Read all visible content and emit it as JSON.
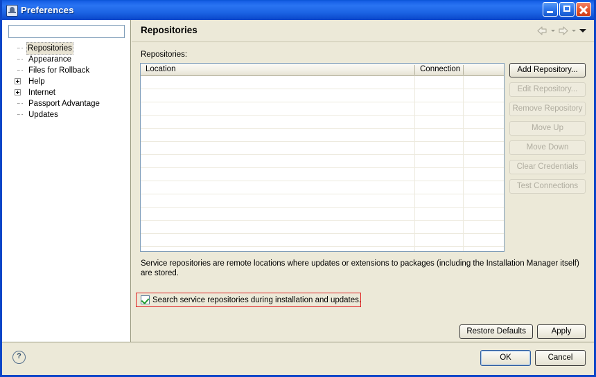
{
  "window": {
    "title": "Preferences",
    "icon": "app-icon",
    "controls": {
      "minimize": "minimize-icon",
      "maximize": "maximize-icon",
      "close": "close-icon"
    }
  },
  "sidebar": {
    "filter": {
      "value": "",
      "placeholder": ""
    },
    "tree": [
      {
        "label": "Repositories",
        "expandable": false,
        "selected": true
      },
      {
        "label": "Appearance",
        "expandable": false,
        "selected": false
      },
      {
        "label": "Files for Rollback",
        "expandable": false,
        "selected": false
      },
      {
        "label": "Help",
        "expandable": true,
        "selected": false
      },
      {
        "label": "Internet",
        "expandable": true,
        "selected": false
      },
      {
        "label": "Passport Advantage",
        "expandable": false,
        "selected": false
      },
      {
        "label": "Updates",
        "expandable": false,
        "selected": false
      }
    ]
  },
  "content": {
    "page_title": "Repositories",
    "nav": {
      "back": "back-arrow-icon",
      "back_caret": "chevron-down-icon",
      "forward": "forward-arrow-icon",
      "forward_caret": "chevron-down-icon",
      "menu": "dropdown-arrow-icon"
    },
    "section_label": "Repositories:",
    "table": {
      "columns": [
        "Location",
        "Connection",
        ""
      ],
      "rows": [],
      "empty_row_count": 13
    },
    "side_buttons": [
      {
        "label": "Add Repository...",
        "enabled": true
      },
      {
        "label": "Edit Repository...",
        "enabled": false
      },
      {
        "label": "Remove Repository",
        "enabled": false
      },
      {
        "label": "Move Up",
        "enabled": false
      },
      {
        "label": "Move Down",
        "enabled": false
      },
      {
        "label": "Clear Credentials",
        "enabled": false
      },
      {
        "label": "Test Connections",
        "enabled": false
      }
    ],
    "description": "Service repositories are remote locations where updates or extensions to packages (including the Installation Manager itself) are stored.",
    "checkbox": {
      "label": "Search service repositories during installation and updates.",
      "checked": true,
      "highlight_color": "#e02020"
    },
    "restore_defaults_label": "Restore Defaults",
    "apply_label": "Apply"
  },
  "footer": {
    "help_icon": "?",
    "ok_label": "OK",
    "cancel_label": "Cancel"
  }
}
